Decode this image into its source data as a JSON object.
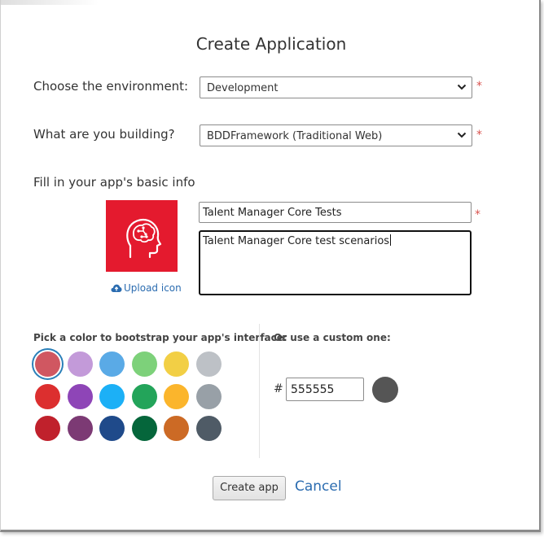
{
  "dialog": {
    "title": "Create Application"
  },
  "environment": {
    "label": "Choose the environment:",
    "selected": "Development"
  },
  "building": {
    "label": "What are you building?",
    "selected": "BDDFramework (Traditional Web)"
  },
  "basic_info": {
    "label": "Fill in your app's basic info",
    "upload_label": "Upload icon",
    "name_value": "Talent Manager Core Tests",
    "description_value": "Talent Manager Core test scenarios",
    "icon_color": "#e41a2e"
  },
  "required_marker": "*",
  "colors": {
    "pick_label": "Pick a color to bootstrap your app's interface:",
    "custom_label": "Or use a custom one:",
    "hash_symbol": "#",
    "custom_value": "555555",
    "custom_color": "#555555",
    "selected_index": 0,
    "swatches": [
      "#d05761",
      "#c39ad9",
      "#5aaae6",
      "#7dd17a",
      "#f2cf45",
      "#bdc1c6",
      "#dc2f2f",
      "#8e45b7",
      "#1cb0f6",
      "#23a45a",
      "#fbb52c",
      "#98a0a7",
      "#c0212c",
      "#7c3a74",
      "#1f4a8a",
      "#05663b",
      "#cc6a25",
      "#4f5b66"
    ]
  },
  "actions": {
    "create_label": "Create app",
    "cancel_label": "Cancel"
  }
}
